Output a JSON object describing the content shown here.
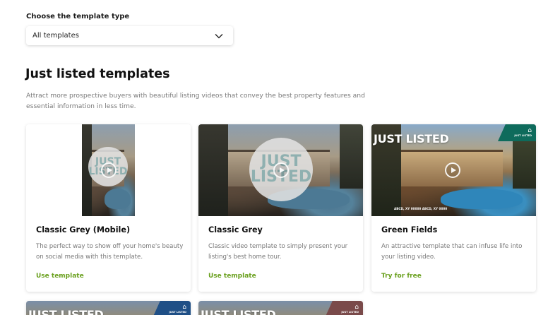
{
  "filter": {
    "label": "Choose the template type",
    "selected": "All templates"
  },
  "section": {
    "title": "Just listed templates",
    "description": "Attract more prospective buyers with beautiful listing videos that convey the best property features and essential information in less time."
  },
  "cards": [
    {
      "title": "Classic Grey (Mobile)",
      "description": "The perfect way to show off your home's beauty on social media with this template.",
      "action": "Use template",
      "seal_line1": "JUST",
      "seal_line2": "LISTED"
    },
    {
      "title": "Classic Grey",
      "description": "Classic video template to simply present your listing's best home tour.",
      "action": "Use template",
      "seal_line1": "JUST",
      "seal_line2": "LISTED"
    },
    {
      "title": "Green Fields",
      "description": "An attractive template that can infuse life into your listing video.",
      "action": "Try for free",
      "overlay": "JUST LISTED",
      "badge": "JUST LISTED",
      "address": "ABCD, XY 00000 ABCD, XY 0000",
      "accent": "#0e6b5c"
    },
    {
      "overlay": "JUST LISTED",
      "badge": "JUST LISTED",
      "accent": "#1f4f86"
    },
    {
      "overlay": "JUST LISTED",
      "badge": "JUST LISTED",
      "accent": "#7a4a4a"
    }
  ],
  "colors": {
    "link": "#6aa01e",
    "muted_text": "#777777"
  }
}
